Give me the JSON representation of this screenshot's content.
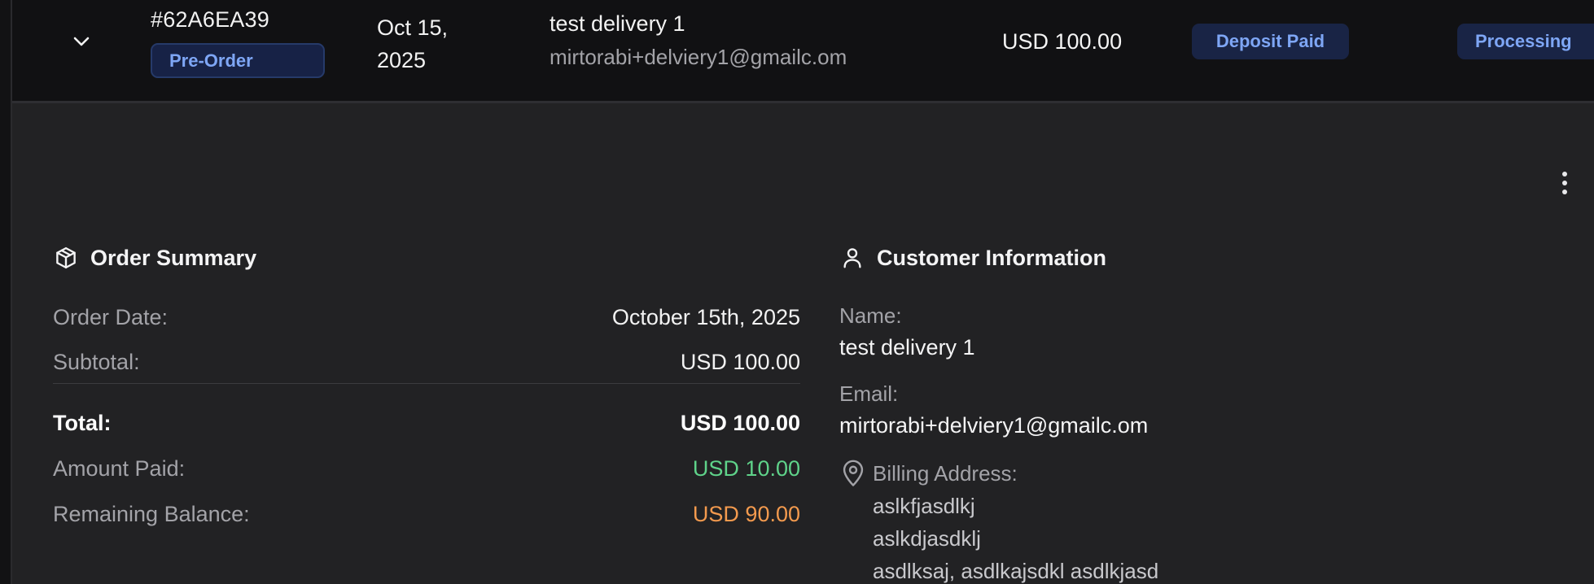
{
  "order": {
    "id": "#62A6EA39",
    "type_badge": "Pre-Order",
    "date": "Oct 15, 2025",
    "customer_name": "test delivery 1",
    "customer_email": "mirtorabi+delviery1@gmailc.om",
    "total": "USD 100.00",
    "payment_status": "Deposit Paid",
    "fulfillment_status": "Processing"
  },
  "icons": {
    "expand": "chevron-down-icon",
    "menu": "more-vertical-icon",
    "summary": "package-icon",
    "customer": "user-icon",
    "billing": "map-pin-icon"
  },
  "colors": {
    "badge_bg": "#192445",
    "badge_text": "#7ea6f5",
    "amount_paid": "#5fd38a",
    "remaining_balance": "#f39a4e"
  },
  "order_summary": {
    "title": "Order Summary",
    "order_date_label": "Order Date:",
    "order_date_value": "October 15th, 2025",
    "subtotal_label": "Subtotal:",
    "subtotal_value": "USD 100.00",
    "total_label": "Total:",
    "total_value": "USD 100.00",
    "amount_paid_label": "Amount Paid:",
    "amount_paid_value": "USD 10.00",
    "remaining_label": "Remaining Balance:",
    "remaining_value": "USD 90.00"
  },
  "customer_info": {
    "title": "Customer Information",
    "name_label": "Name:",
    "name_value": "test delivery 1",
    "email_label": "Email:",
    "email_value": "mirtorabi+delviery1@gmailc.om",
    "billing_label": "Billing Address:",
    "billing_lines": [
      "aslkfjasdlkj",
      "aslkdjasdklj",
      "asdlksaj, asdlkajsdkl asdlkjasd"
    ]
  }
}
